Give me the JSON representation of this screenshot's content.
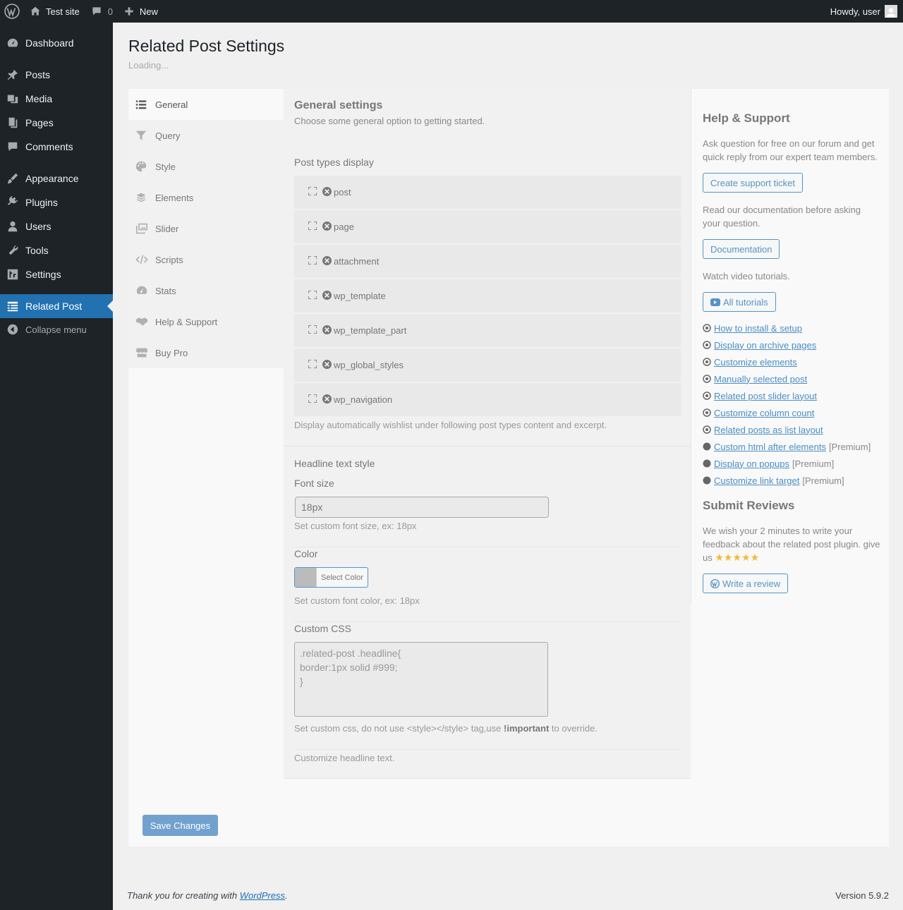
{
  "adminbar": {
    "site_name": "Test site",
    "comments_count": "0",
    "new_label": "New",
    "howdy": "Howdy, user"
  },
  "sidebar": {
    "items": [
      {
        "label": "Dashboard",
        "icon": "dashboard-icon"
      },
      {
        "label": "Posts",
        "icon": "pin-icon"
      },
      {
        "label": "Media",
        "icon": "media-icon"
      },
      {
        "label": "Pages",
        "icon": "pages-icon"
      },
      {
        "label": "Comments",
        "icon": "comment-icon"
      },
      {
        "label": "Appearance",
        "icon": "brush-icon"
      },
      {
        "label": "Plugins",
        "icon": "plug-icon"
      },
      {
        "label": "Users",
        "icon": "user-icon"
      },
      {
        "label": "Tools",
        "icon": "wrench-icon"
      },
      {
        "label": "Settings",
        "icon": "settings-icon"
      },
      {
        "label": "Related Post",
        "icon": "list-icon"
      },
      {
        "label": "Collapse menu",
        "icon": "collapse-icon"
      }
    ]
  },
  "page": {
    "title": "Related Post Settings",
    "loading": "Loading..."
  },
  "tabs": [
    {
      "label": "General",
      "icon": "list-icon"
    },
    {
      "label": "Query",
      "icon": "filter-icon"
    },
    {
      "label": "Style",
      "icon": "palette-icon"
    },
    {
      "label": "Elements",
      "icon": "layers-icon"
    },
    {
      "label": "Slider",
      "icon": "images-icon"
    },
    {
      "label": "Scripts",
      "icon": "code-icon"
    },
    {
      "label": "Stats",
      "icon": "gauge-icon"
    },
    {
      "label": "Help & Support",
      "icon": "handshake-icon"
    },
    {
      "label": "Buy Pro",
      "icon": "store-icon"
    }
  ],
  "general": {
    "heading": "General settings",
    "subheading": "Choose some general option to getting started.",
    "post_types_label": "Post types display",
    "post_types": [
      "post",
      "page",
      "attachment",
      "wp_template",
      "wp_template_part",
      "wp_global_styles",
      "wp_navigation"
    ],
    "post_types_desc": "Display automatically wishlist under following post types content and excerpt.",
    "headline_label": "Headline text style",
    "font_size_label": "Font size",
    "font_size_value": "18px",
    "font_size_desc": "Set custom font size, ex: 18px",
    "color_label": "Color",
    "select_color": "Select Color",
    "color_desc": "Set custom font color, ex: 18px",
    "css_label": "Custom CSS",
    "css_value": ".related-post .headline{\nborder:1px solid #999;\n}",
    "css_desc_pre": "Set custom css, do not use <style></style> tag,use ",
    "css_desc_bold": "!important",
    "css_desc_post": " to override.",
    "headline_desc": "Customize headline text."
  },
  "help": {
    "title": "Help & Support",
    "forum_text": "Ask question for free on our forum and get quick reply from our expert team members.",
    "ticket_button": "Create support ticket",
    "docs_text": "Read our documentation before asking your question.",
    "docs_button": "Documentation",
    "video_text": "Watch video tutorials.",
    "tutorials_button": "All tutorials",
    "tutorials": [
      {
        "label": "How to install & setup",
        "premium": ""
      },
      {
        "label": "Display on archive pages",
        "premium": ""
      },
      {
        "label": "Customize elements",
        "premium": ""
      },
      {
        "label": "Manually selected post",
        "premium": ""
      },
      {
        "label": "Related post slider layout",
        "premium": ""
      },
      {
        "label": "Customize column count",
        "premium": ""
      },
      {
        "label": "Related posts as list layout",
        "premium": ""
      },
      {
        "label": "Custom html after elements",
        "premium": "[Premium]"
      },
      {
        "label": "Display on popups",
        "premium": "[Premium]"
      },
      {
        "label": "Customize link target",
        "premium": "[Premium]"
      }
    ],
    "reviews_title": "Submit Reviews",
    "reviews_text": "We wish your 2 minutes to write your feedback about the related post plugin. give us",
    "stars": "★★★★★",
    "review_button": "Write a review"
  },
  "save_button": "Save Changes",
  "footer": {
    "thanks_pre": "Thank you for creating with ",
    "thanks_link": "WordPress",
    "thanks_post": ".",
    "version": "Version 5.9.2"
  },
  "colors": {
    "admin_dark": "#1d2327",
    "accent": "#2271b1"
  }
}
